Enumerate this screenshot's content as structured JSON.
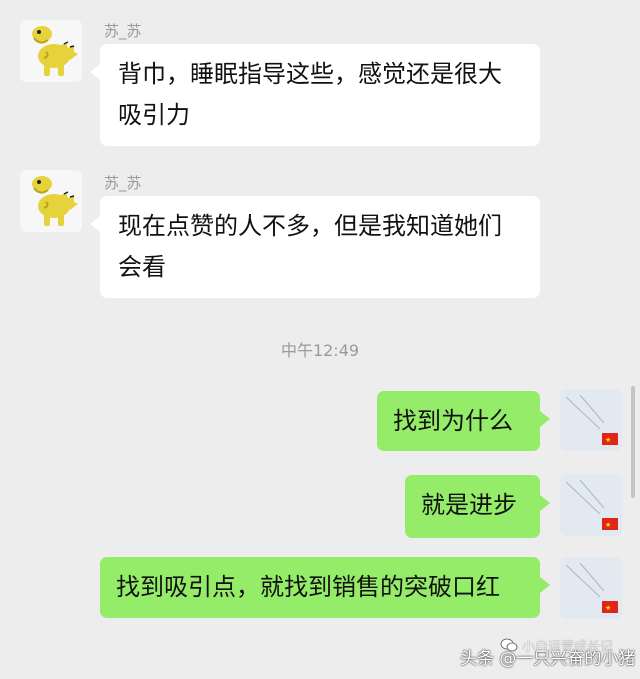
{
  "chat": {
    "messages": [
      {
        "sender": "苏_苏",
        "text": "背巾，睡眠指导这些，感觉还是很大吸引力"
      },
      {
        "sender": "苏_苏",
        "text": "现在点赞的人不多，但是我知道她们会看"
      },
      {
        "text": "找到为什么"
      },
      {
        "text": "就是进步"
      },
      {
        "text": "找到吸引点，就找到销售的突破口红"
      }
    ],
    "timestamp": "中午12:49"
  },
  "watermark": {
    "text": "头条 @一只兴奋的小猪",
    "overlay_text": "小白运营成长记"
  },
  "colors": {
    "background": "#ededed",
    "incoming_bubble": "#ffffff",
    "outgoing_bubble": "#95ec69",
    "name": "#9a9a9a"
  }
}
